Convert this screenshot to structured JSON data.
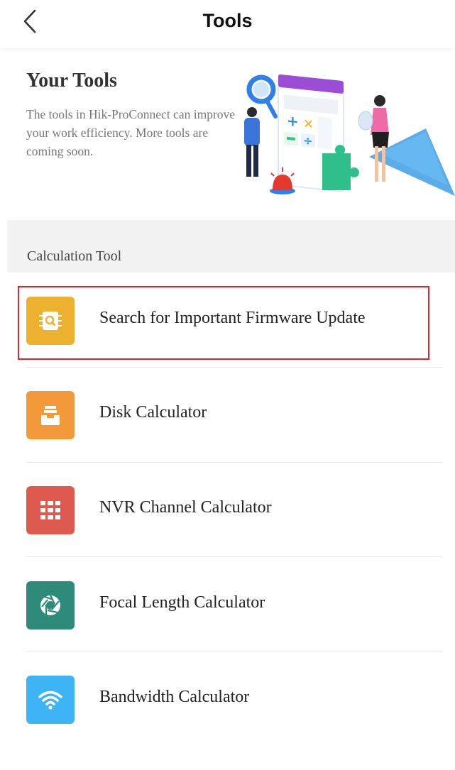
{
  "header": {
    "title": "Tools",
    "back_icon": "chevron-left-icon"
  },
  "banner": {
    "title": "Your Tools",
    "description": "The tools in Hik-ProConnect can improve your work efficiency. More tools are coming soon."
  },
  "section": {
    "label": "Calculation Tool"
  },
  "tools": [
    {
      "label": "Search for Important Firmware Update",
      "icon": "firmware-search-icon",
      "color": "#ecb12f",
      "highlighted": true
    },
    {
      "label": "Disk Calculator",
      "icon": "disk-tray-icon",
      "color": "#f29a3a"
    },
    {
      "label": "NVR Channel Calculator",
      "icon": "grid-icon",
      "color": "#df5a4e"
    },
    {
      "label": "Focal Length Calculator",
      "icon": "aperture-icon",
      "color": "#2e8b7a"
    },
    {
      "label": "Bandwidth Calculator",
      "icon": "wifi-icon",
      "color": "#3fb4f5"
    }
  ],
  "colors": {
    "highlight_border": "#e0252a",
    "section_background": "#f2f2f2"
  }
}
